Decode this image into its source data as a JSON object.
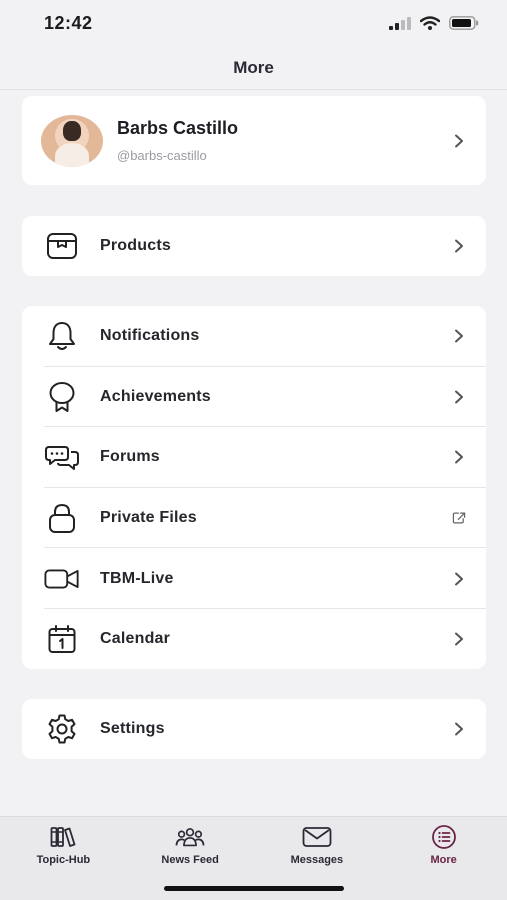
{
  "status_bar": {
    "time": "12:42"
  },
  "header": {
    "title": "More"
  },
  "profile": {
    "name": "Barbs Castillo",
    "handle": "@barbs-castillo"
  },
  "sections": {
    "products": {
      "label": "Products",
      "icon": "box-icon"
    },
    "items": [
      {
        "label": "Notifications",
        "icon": "bell-icon",
        "action": "chevron"
      },
      {
        "label": "Achievements",
        "icon": "award-icon",
        "action": "chevron"
      },
      {
        "label": "Forums",
        "icon": "chat-bubbles-icon",
        "action": "chevron"
      },
      {
        "label": "Private Files",
        "icon": "lock-icon",
        "action": "external-link"
      },
      {
        "label": "TBM-Live",
        "icon": "video-camera-icon",
        "action": "chevron"
      },
      {
        "label": "Calendar",
        "icon": "calendar-icon",
        "action": "chevron"
      }
    ],
    "settings": {
      "label": "Settings",
      "icon": "gear-icon"
    }
  },
  "tab_bar": {
    "tabs": [
      {
        "label": "Topic-Hub",
        "icon": "books-icon",
        "active": false
      },
      {
        "label": "News Feed",
        "icon": "people-icon",
        "active": false
      },
      {
        "label": "Messages",
        "icon": "envelope-icon",
        "active": false
      },
      {
        "label": "More",
        "icon": "list-icon",
        "active": true
      }
    ]
  },
  "colors": {
    "accent": "#6a2345",
    "background": "#f2f2f4",
    "card": "#ffffff"
  }
}
